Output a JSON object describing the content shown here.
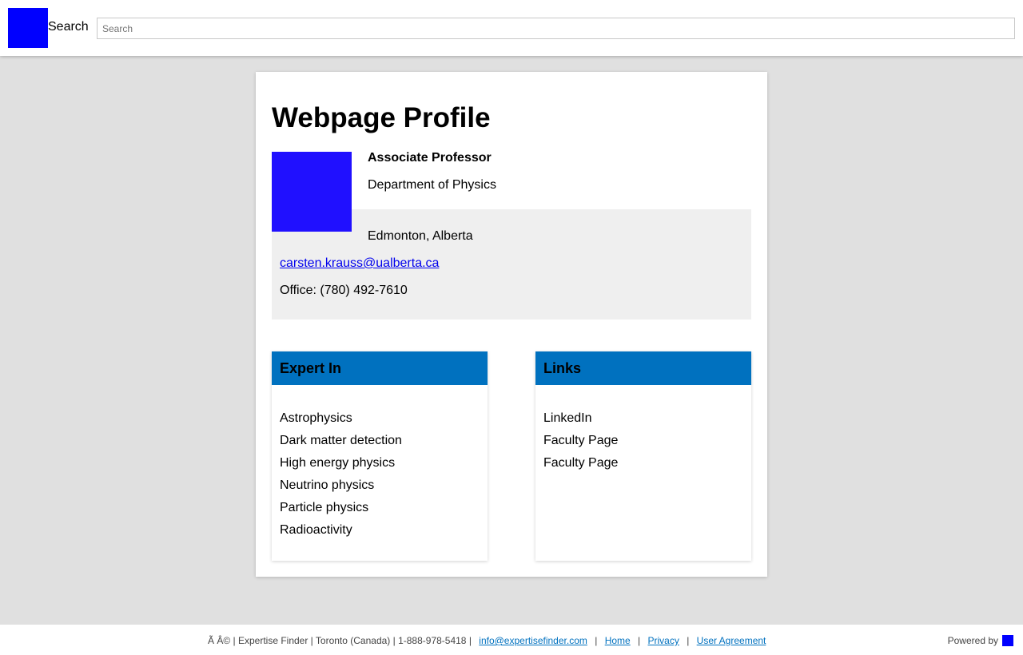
{
  "header": {
    "search_label": "Search",
    "search_placeholder": "Search"
  },
  "profile": {
    "page_title": "Webpage Profile",
    "position": "Associate Professor",
    "department": "Department of Physics",
    "location": "Edmonton, Alberta",
    "email": "carsten.krauss@ualberta.ca",
    "office": "Office: (780) 492-7610"
  },
  "expert_in": {
    "heading": "Expert In",
    "items": [
      "Astrophysics",
      "Dark matter detection",
      "High energy physics",
      "Neutrino physics",
      "Particle physics",
      "Radioactivity"
    ]
  },
  "links": {
    "heading": "Links",
    "items": [
      "LinkedIn",
      "Faculty Page",
      "Faculty Page"
    ]
  },
  "footer": {
    "copyright": "Ã   Â© | Expertise Finder | Toronto (Canada) | 1-888-978-5418 |",
    "email": "info@expertisefinder.com",
    "home": "Home",
    "privacy": "Privacy",
    "user_agreement": "User Agreement",
    "powered_by": "Powered by"
  },
  "colors": {
    "panel_header": "#0071bf",
    "logo": "#0000ff",
    "avatar": "#2010ff",
    "contact_box": "#efefef"
  }
}
